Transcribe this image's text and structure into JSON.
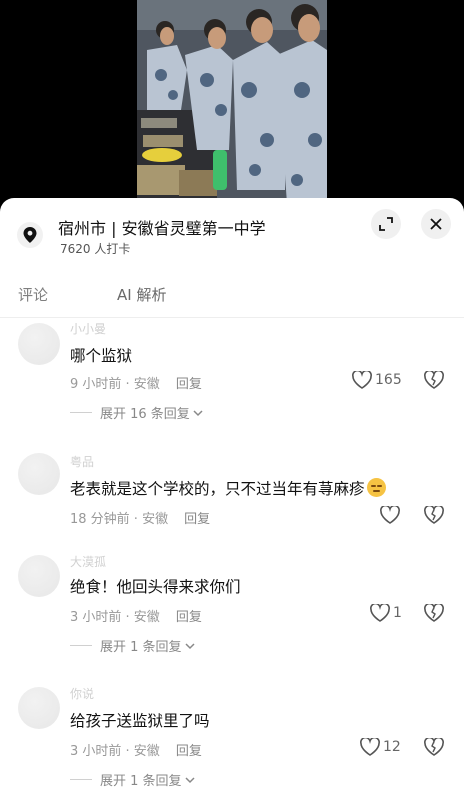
{
  "location": {
    "title": "宿州市 | 安徽省灵璧第一中学",
    "checkins": "7620 人打卡"
  },
  "tabs": [
    {
      "label": "评论"
    },
    {
      "label": "AI 解析"
    }
  ],
  "comments": [
    {
      "username": "小小曼",
      "text": "哪个监狱",
      "time_location": "9 小时前 · 安徽",
      "reply_label": "回复",
      "likes": "165",
      "expand": "展开 16 条回复"
    },
    {
      "username": "粤品",
      "text": "老表就是这个学校的，只不过当年有荨麻疹",
      "time_location": "18 分钟前 · 安徽",
      "reply_label": "回复",
      "likes": ""
    },
    {
      "username": "大漠孤",
      "text": "绝食！他回头得来求你们",
      "time_location": "3 小时前 · 安徽",
      "reply_label": "回复",
      "likes": "1",
      "expand": "展开 1 条回复"
    },
    {
      "username": "你说",
      "text": "给孩子送监狱里了吗",
      "time_location": "3 小时前 · 安徽",
      "reply_label": "回复",
      "likes": "12",
      "expand": "展开 1 条回复"
    }
  ],
  "icons": {
    "location": "map-pin-icon",
    "minimize": "minimize-icon",
    "close": "close-icon",
    "like": "heart-icon",
    "dislike": "broken-heart-icon",
    "chevron": "chevron-down-icon",
    "emoji": "smug-face-emoji-icon"
  },
  "colors": {
    "sheet_bg": "#ffffff",
    "text_primary": "#111111",
    "text_secondary": "#999999"
  }
}
